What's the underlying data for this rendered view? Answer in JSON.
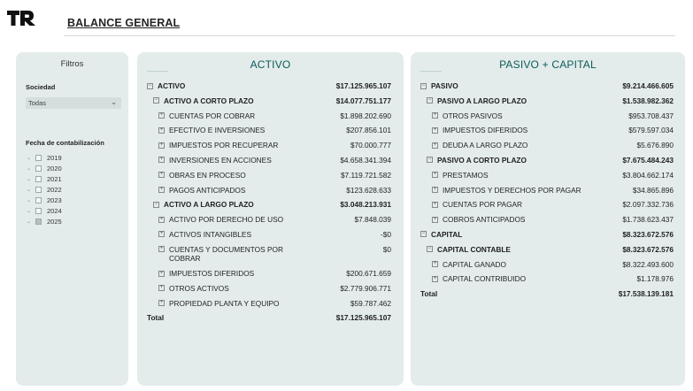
{
  "header": {
    "title": "BALANCE GENERAL",
    "logo_icon": "tr-logo-icon"
  },
  "filters": {
    "title": "Filtros",
    "sociedad_label": "Sociedad",
    "sociedad_value": "Todas",
    "fecha_label": "Fecha de contabilización",
    "years": [
      {
        "label": "2019",
        "checked": false
      },
      {
        "label": "2020",
        "checked": false
      },
      {
        "label": "2021",
        "checked": false
      },
      {
        "label": "2022",
        "checked": false
      },
      {
        "label": "2023",
        "checked": false
      },
      {
        "label": "2024",
        "checked": false
      },
      {
        "label": "2025",
        "checked": true
      }
    ]
  },
  "activo": {
    "title": "ACTIVO",
    "rows": [
      {
        "label": "ACTIVO",
        "value": "$17.125.965.107",
        "level": 0,
        "bold": true,
        "toggle": "minus"
      },
      {
        "label": "ACTIVO A CORTO PLAZO",
        "value": "$14.077.751.177",
        "level": 1,
        "bold": true,
        "toggle": "minus"
      },
      {
        "label": "CUENTAS POR COBRAR",
        "value": "$1.898.202.690",
        "level": 2,
        "bold": false,
        "toggle": "plus"
      },
      {
        "label": "EFECTIVO E INVERSIONES",
        "value": "$207.856.101",
        "level": 2,
        "bold": false,
        "toggle": "plus"
      },
      {
        "label": "IMPUESTOS POR RECUPERAR",
        "value": "$70.000.777",
        "level": 2,
        "bold": false,
        "toggle": "plus"
      },
      {
        "label": "INVERSIONES EN ACCIONES",
        "value": "$4.658.341.394",
        "level": 2,
        "bold": false,
        "toggle": "plus"
      },
      {
        "label": "OBRAS EN PROCESO",
        "value": "$7.119.721.582",
        "level": 2,
        "bold": false,
        "toggle": "plus"
      },
      {
        "label": "PAGOS ANTICIPADOS",
        "value": "$123.628.633",
        "level": 2,
        "bold": false,
        "toggle": "plus"
      },
      {
        "label": "ACTIVO A LARGO PLAZO",
        "value": "$3.048.213.931",
        "level": 1,
        "bold": true,
        "toggle": "minus"
      },
      {
        "label": "ACTIVO POR DERECHO DE USO",
        "value": "$7.848.039",
        "level": 2,
        "bold": false,
        "toggle": "plus"
      },
      {
        "label": "ACTIVOS INTANGIBLES",
        "value": "-$0",
        "level": 2,
        "bold": false,
        "toggle": "plus"
      },
      {
        "label": "CUENTAS Y DOCUMENTOS POR COBRAR",
        "value": "$0",
        "level": 2,
        "bold": false,
        "toggle": "plus"
      },
      {
        "label": "IMPUESTOS DIFERIDOS",
        "value": "$200.671.659",
        "level": 2,
        "bold": false,
        "toggle": "plus"
      },
      {
        "label": "OTROS ACTIVOS",
        "value": "$2.779.906.771",
        "level": 2,
        "bold": false,
        "toggle": "plus"
      },
      {
        "label": "PROPIEDAD PLANTA Y EQUIPO",
        "value": "$59.787.462",
        "level": 2,
        "bold": false,
        "toggle": "plus"
      }
    ],
    "total_label": "Total",
    "total_value": "$17.125.965.107"
  },
  "pasivo": {
    "title": "PASIVO + CAPITAL",
    "rows": [
      {
        "label": "PASIVO",
        "value": "$9.214.466.605",
        "level": 0,
        "bold": true,
        "toggle": "minus"
      },
      {
        "label": "PASIVO A LARGO PLAZO",
        "value": "$1.538.982.362",
        "level": 1,
        "bold": true,
        "toggle": "minus"
      },
      {
        "label": "OTROS PASIVOS",
        "value": "$953.708.437",
        "level": 2,
        "bold": false,
        "toggle": "plus"
      },
      {
        "label": "IMPUESTOS DIFERIDOS",
        "value": "$579.597.034",
        "level": 2,
        "bold": false,
        "toggle": "plus"
      },
      {
        "label": "DEUDA A LARGO PLAZO",
        "value": "$5.676.890",
        "level": 2,
        "bold": false,
        "toggle": "plus"
      },
      {
        "label": "PASIVO A CORTO PLAZO",
        "value": "$7.675.484.243",
        "level": 1,
        "bold": true,
        "toggle": "minus"
      },
      {
        "label": "PRESTAMOS",
        "value": "$3.804.662.174",
        "level": 2,
        "bold": false,
        "toggle": "plus"
      },
      {
        "label": "IMPUESTOS Y DERECHOS POR PAGAR",
        "value": "$34.865.896",
        "level": 2,
        "bold": false,
        "toggle": "plus"
      },
      {
        "label": "CUENTAS POR PAGAR",
        "value": "$2.097.332.736",
        "level": 2,
        "bold": false,
        "toggle": "plus"
      },
      {
        "label": "COBROS ANTICIPADOS",
        "value": "$1.738.623.437",
        "level": 2,
        "bold": false,
        "toggle": "plus"
      },
      {
        "label": "CAPITAL",
        "value": "$8.323.672.576",
        "level": 0,
        "bold": true,
        "toggle": "minus"
      },
      {
        "label": "CAPITAL CONTABLE",
        "value": "$8.323.672.576",
        "level": 1,
        "bold": true,
        "toggle": "minus"
      },
      {
        "label": "CAPITAL GANADO",
        "value": "$8.322.493.600",
        "level": 2,
        "bold": false,
        "toggle": "plus"
      },
      {
        "label": "CAPITAL CONTRIBUIDO",
        "value": "$1.178.976",
        "level": 2,
        "bold": false,
        "toggle": "plus"
      }
    ],
    "total_label": "Total",
    "total_value": "$17.538.139.181"
  },
  "colors": {
    "panel_bg": "#e3eceb",
    "title_teal": "#0d5a59"
  }
}
